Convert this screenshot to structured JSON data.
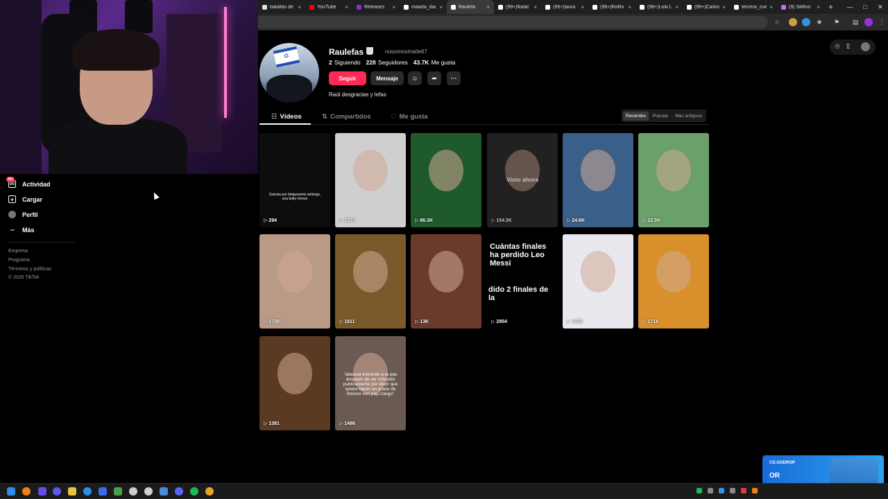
{
  "browser": {
    "tabs": [
      {
        "label": "batallas de",
        "color": "#e0e0e0"
      },
      {
        "label": "YouTube",
        "color": "#ff0000"
      },
      {
        "label": "Releases",
        "color": "#8a2be2"
      },
      {
        "label": "maarta_dia",
        "color": "#ffffff"
      },
      {
        "label": "Raulefa",
        "color": "#ffffff"
      },
      {
        "label": "(99+)Natal",
        "color": "#ffffff"
      },
      {
        "label": "(99+)laura",
        "color": "#ffffff"
      },
      {
        "label": "(99+)RoRo",
        "color": "#ffffff"
      },
      {
        "label": "(99+)Lola L",
        "color": "#ffffff"
      },
      {
        "label": "(99+)Carlos",
        "color": "#ffffff"
      },
      {
        "label": "tercera_cue",
        "color": "#ffffff"
      },
      {
        "label": "(9) Silithur",
        "color": "#c36cff"
      }
    ],
    "active_tab_index": 4
  },
  "nav": {
    "items": [
      {
        "label": "Actividad",
        "badge": "99+"
      },
      {
        "label": "Cargar"
      },
      {
        "label": "Perfil"
      },
      {
        "label": "Más"
      }
    ],
    "footer": [
      "Empresa",
      "Programa",
      "Términos y políticas",
      "© 2026 TikTok"
    ]
  },
  "profile": {
    "username": "Raulefas",
    "nickname": "nosomosmaite67",
    "following_count": "2",
    "following_label": "Siguiendo",
    "followers_count": "228",
    "followers_label": "Seguidores",
    "likes_count": "43.7K",
    "likes_label": "Me gusta",
    "follow_label": "Seguir",
    "message_label": "Mensaje",
    "bio": "Raúl desgracias y lefas"
  },
  "tabs": [
    {
      "label": "Vídeos",
      "icon": "grid-icon"
    },
    {
      "label": "Compartidos",
      "icon": "repost-icon"
    },
    {
      "label": "Me gusta",
      "icon": "heart-icon"
    }
  ],
  "sort": [
    "Recientes",
    "Popular",
    "Más antiguos"
  ],
  "videos": [
    {
      "views": "294",
      "overlay": "Gracias por bloquearme antiorgo, una bully menos",
      "bg": "#0d0d0d"
    },
    {
      "views": "1677",
      "overlay": "",
      "bg": "#cfcfcf"
    },
    {
      "views": "86.3K",
      "overlay": "",
      "bg": "#1f5a2c"
    },
    {
      "views": "154.5K",
      "overlay": "",
      "bg": "#2c2c2c",
      "watched": "Visto ahora"
    },
    {
      "views": "24.6K",
      "overlay": "",
      "bg": "#3a5f88"
    },
    {
      "views": "22.5K",
      "overlay": "",
      "bg": "#6aa06a"
    },
    {
      "views": "2738",
      "overlay": "",
      "bg": "#b89a86"
    },
    {
      "views": "1611",
      "overlay": "",
      "bg": "#7a5a2a"
    },
    {
      "views": "13K",
      "overlay": "",
      "bg": "#6a3a2a"
    },
    {
      "views": "2954",
      "overlay": "Cuántas finales ha perdido Leo Messi",
      "overlay2": "dido 2 finales de la",
      "bg": "#000000"
    },
    {
      "views": "1633",
      "overlay": "",
      "bg": "#e8e8ee"
    },
    {
      "views": "1714",
      "overlay": "",
      "bg": "#d8902c"
    },
    {
      "views": "1381",
      "overlay": "",
      "bg": "#5a3a22"
    },
    {
      "views": "1486",
      "overlay": "\"abascal entrando a la pau despues de ser criticado publicamente por decir que quiere hacer un grado de folclore con papi Diego\"",
      "bg": "#6a5a52"
    }
  ],
  "widget": {
    "brand": "CS:GODROP",
    "text": "OR"
  }
}
